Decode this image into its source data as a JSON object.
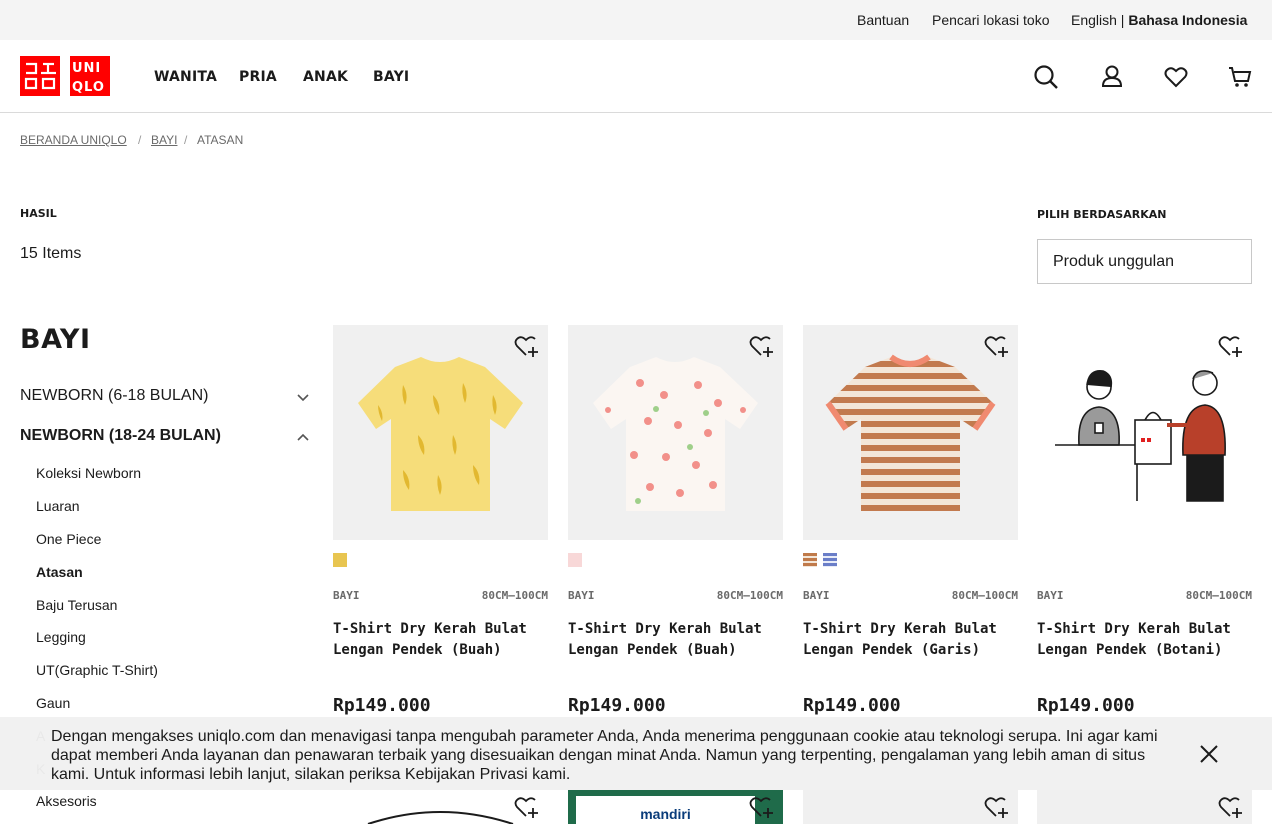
{
  "utility": {
    "help": "Bantuan",
    "store_locator": "Pencari lokasi toko",
    "lang_en": "English | ",
    "lang_id": "Bahasa Indonesia"
  },
  "header": {
    "logo_top": "ユニ",
    "logo_top_right": "UNI",
    "logo_bottom": "クロ",
    "logo_bottom_right": "QLO",
    "nav": [
      "WANITA",
      "PRIA",
      "ANAK",
      "BAYI"
    ],
    "icons": [
      "search-icon",
      "account-icon",
      "wishlist-icon",
      "cart-icon"
    ]
  },
  "breadcrumb": [
    "BERANDA UNIQLO",
    "BAYI",
    "ATASAN"
  ],
  "results": {
    "label": "HASIL",
    "count": "15 Items",
    "sort_label": "PILIH BERDASARKAN",
    "sort_value": "Produk unggulan"
  },
  "sidebar": {
    "title": "BAYI",
    "groups": [
      {
        "label": "NEWBORN (6-18 BULAN)",
        "expanded": false
      },
      {
        "label": "NEWBORN (18-24 BULAN)",
        "expanded": true
      }
    ],
    "items": [
      "Koleksi Newborn",
      "Luaran",
      "One Piece",
      "Atasan",
      "Baju Terusan",
      "Legging",
      "UT(Graphic T-Shirt)",
      "Gaun",
      "A",
      "K",
      "Aksesoris"
    ],
    "active_item": "Atasan"
  },
  "products": [
    {
      "gender": "BAYI",
      "size": "80CM–100CM",
      "name": "T-Shirt Dry Kerah Bulat Lengan Pendek (Buah)",
      "price": "Rp149.000",
      "swatches": [
        "#e8c550"
      ]
    },
    {
      "gender": "BAYI",
      "size": "80CM–100CM",
      "name": "T-Shirt Dry Kerah Bulat Lengan Pendek (Buah)",
      "price": "Rp149.000",
      "swatches": [
        "#f0a0a0"
      ]
    },
    {
      "gender": "BAYI",
      "size": "80CM–100CM",
      "name": "T-Shirt Dry Kerah Bulat Lengan Pendek (Garis)",
      "price": "Rp149.000",
      "swatches": [
        "#c07a4a",
        "#6a7ec8"
      ]
    },
    {
      "gender": "BAYI",
      "size": "80CM–100CM",
      "name": "T-Shirt Dry Kerah Bulat Lengan Pendek (Botani)",
      "price": "Rp149.000",
      "swatches": []
    }
  ],
  "second_row_logo_text": "mandiri",
  "cookie": {
    "text": "Dengan mengakses uniqlo.com dan menavigasi tanpa mengubah parameter Anda, Anda menerima penggunaan cookie atau teknologi serupa. Ini agar kami dapat memberi Anda layanan dan penawaran terbaik yang disesuaikan dengan minat Anda. Namun yang terpenting, pengalaman yang lebih aman di situs kami. Untuk informasi lebih lanjut, silakan periksa Kebijakan Privasi kami."
  },
  "colors": {
    "brand_red": "#ff0000",
    "tshirt_yellow": "#f6dd7a",
    "stripe_brown": "#c27a4e",
    "collar_coral": "#f08a70"
  }
}
